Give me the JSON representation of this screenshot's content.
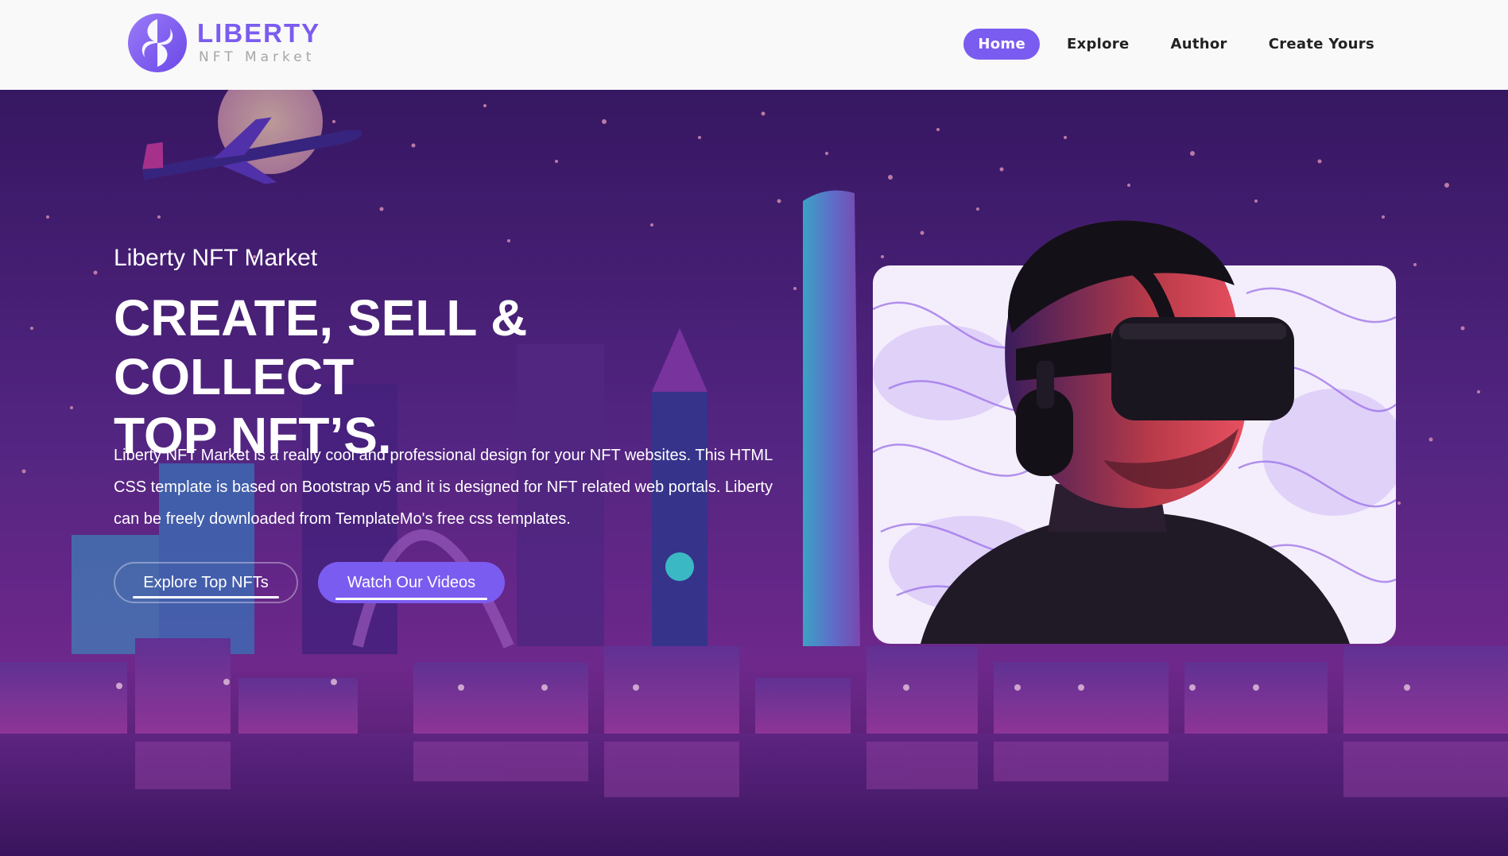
{
  "brand": {
    "title": "LIBERTY",
    "subtitle": "NFT Market",
    "accent_color": "#7b5cf0"
  },
  "nav": {
    "items": [
      {
        "label": "Home",
        "active": true
      },
      {
        "label": "Explore",
        "active": false
      },
      {
        "label": "Author",
        "active": false
      },
      {
        "label": "Create Yours",
        "active": false
      }
    ]
  },
  "hero": {
    "subtitle": "Liberty NFT Market",
    "title_line1": "CREATE, SELL & COLLECT",
    "title_line2": "TOP NFT’S.",
    "description": "Liberty NFT Market is a really cool and professional design for your NFT websites. This HTML CSS template is based on Bootstrap v5 and it is designed for NFT related web portals. Liberty can be freely downloaded from TemplateMo's free css templates.",
    "primary_button": "Explore Top NFTs",
    "secondary_button": "Watch Our Videos",
    "image": "vr-headset-man-icon"
  }
}
